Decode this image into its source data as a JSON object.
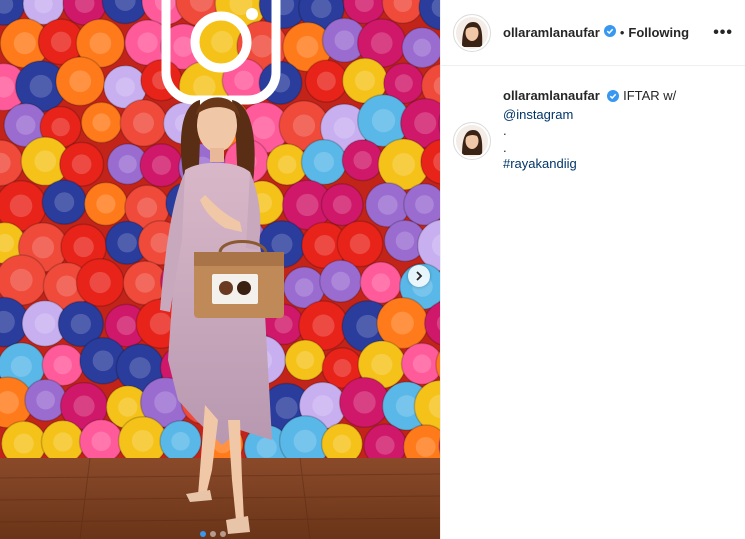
{
  "post": {
    "username": "ollaramlanaufar",
    "separator": "•",
    "follow_status": "Following",
    "more_label": "•••",
    "caption": {
      "text_1": "IFTAR w/",
      "mention": "@instagram",
      "line_dot_1": ".",
      "line_dot_2": ".",
      "hashtag": "#rayakandiig"
    }
  },
  "colors": {
    "verified": "#3897f0",
    "link": "#003569",
    "text": "#262626",
    "border": "#efefef"
  },
  "carousel": {
    "next_icon": "chevron-right-icon",
    "slide_count": 3,
    "active_slide": 1
  }
}
